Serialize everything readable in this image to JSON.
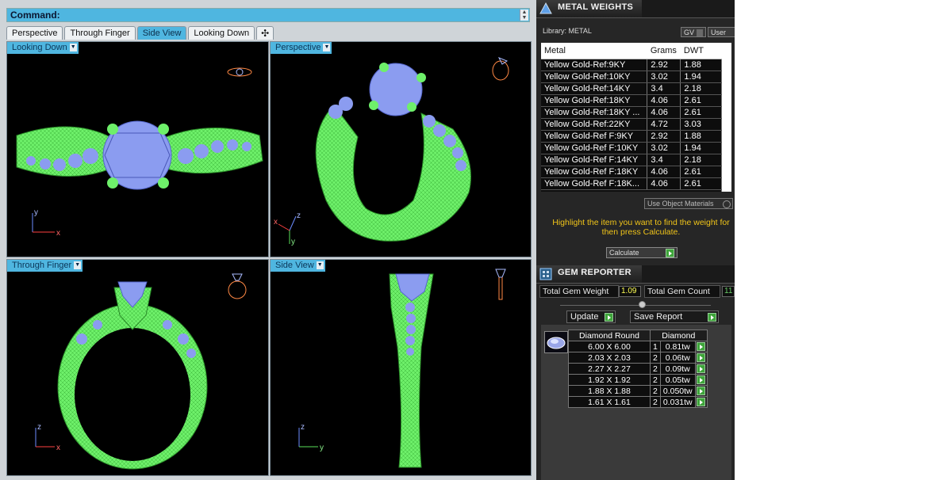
{
  "command": {
    "label": "Command:"
  },
  "tabs": [
    "Perspective",
    "Through Finger",
    "Side View",
    "Looking Down",
    "✣"
  ],
  "active_tab": "Side View",
  "viewports": {
    "top_left": "Looking Down",
    "top_right": "Perspective",
    "bottom_left": "Through Finger",
    "bottom_right": "Side View"
  },
  "axes": {
    "top_left": [
      "y",
      "x"
    ],
    "top_right": [
      "z",
      "x",
      "y"
    ],
    "bottom_left": [
      "z",
      "x"
    ],
    "bottom_right": [
      "z",
      "y"
    ]
  },
  "metal_weights": {
    "title": "METAL WEIGHTS",
    "library": "Library: METAL",
    "btn_gv": "GV",
    "btn_user": "User",
    "columns": [
      "Metal",
      "Grams",
      "DWT"
    ],
    "rows": [
      [
        "Yellow Gold-Ref:9KY",
        "2.92",
        "1.88"
      ],
      [
        "Yellow Gold-Ref:10KY",
        "3.02",
        "1.94"
      ],
      [
        "Yellow Gold-Ref:14KY",
        "3.4",
        "2.18"
      ],
      [
        "Yellow Gold-Ref:18KY",
        "4.06",
        "2.61"
      ],
      [
        "Yellow Gold-Ref:18KY ...",
        "4.06",
        "2.61"
      ],
      [
        "Yellow Gold-Ref:22KY",
        "4.72",
        "3.03"
      ],
      [
        "Yellow Gold-Ref F:9KY",
        "2.92",
        "1.88"
      ],
      [
        "Yellow Gold-Ref F:10KY",
        "3.02",
        "1.94"
      ],
      [
        "Yellow Gold-Ref F:14KY",
        "3.4",
        "2.18"
      ],
      [
        "Yellow Gold-Ref F:18KY",
        "4.06",
        "2.61"
      ],
      [
        "Yellow Gold-Ref F:18K...",
        "4.06",
        "2.61"
      ]
    ],
    "use_object_materials": "Use Object Materials",
    "hint": "Highlight the item you want to find the weight for then press Calculate.",
    "calculate": "Calculate"
  },
  "gem_reporter": {
    "title": "GEM REPORTER",
    "total_weight_label": "Total Gem Weight",
    "total_weight_value": "1.09",
    "total_count_label": "Total Gem Count",
    "total_count_value": "11",
    "update": "Update",
    "save_report": "Save Report",
    "columns": [
      "Diamond Round",
      "Diamond"
    ],
    "rows": [
      [
        "6.00 X 6.00",
        "1",
        "0.81tw"
      ],
      [
        "2.03 X 2.03",
        "2",
        "0.06tw"
      ],
      [
        "2.27 X 2.27",
        "2",
        "0.09tw"
      ],
      [
        "1.92 X 1.92",
        "2",
        "0.05tw"
      ],
      [
        "1.88 X 1.88",
        "2",
        "0.050tw"
      ],
      [
        "1.61 X 1.61",
        "2",
        "0.031tw"
      ]
    ]
  }
}
